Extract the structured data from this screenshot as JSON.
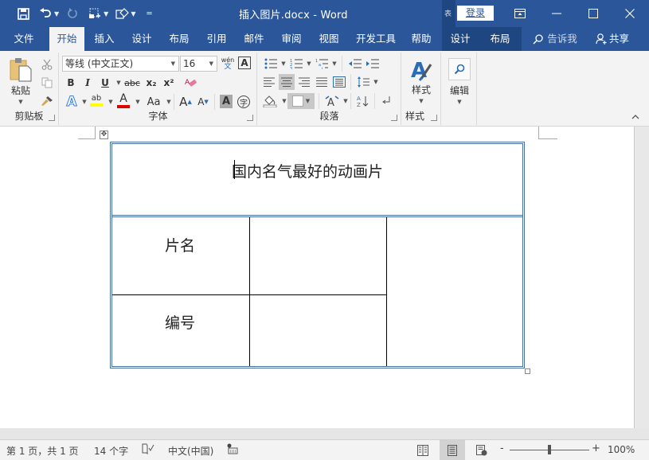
{
  "app": {
    "title": "插入图片.docx  -  Word",
    "login_label": "登录",
    "context_indicator": "表"
  },
  "quick_access": {
    "save_icon": "save-icon",
    "undo_icon": "undo-icon",
    "redo_icon": "redo-icon",
    "insert_picture_icon": "insert-picture-icon",
    "shapes_icon": "shapes-icon",
    "customize_icon": "customize-qat-icon"
  },
  "window_controls": [
    "ribbon-display-options",
    "minimize",
    "maximize",
    "close"
  ],
  "tabs": [
    {
      "label": "文件",
      "active": false
    },
    {
      "label": "开始",
      "active": true
    },
    {
      "label": "插入",
      "active": false
    },
    {
      "label": "设计",
      "active": false
    },
    {
      "label": "布局",
      "active": false
    },
    {
      "label": "引用",
      "active": false
    },
    {
      "label": "邮件",
      "active": false
    },
    {
      "label": "审阅",
      "active": false
    },
    {
      "label": "视图",
      "active": false
    },
    {
      "label": "开发工具",
      "active": false
    },
    {
      "label": "帮助",
      "active": false
    }
  ],
  "context_tabs": [
    {
      "label": "设计"
    },
    {
      "label": "布局"
    }
  ],
  "tell_me": "告诉我",
  "share": "共享",
  "ribbon": {
    "clipboard": {
      "label": "剪贴板",
      "paste_label": "粘贴"
    },
    "font": {
      "label": "字体",
      "font_name": "等线 (中文正文)",
      "font_size": "16",
      "phonetic_top": "wén",
      "phonetic_bottom": "文",
      "bold": "B",
      "italic": "I",
      "underline": "U",
      "strikethrough": "abc",
      "subscript": "x₂",
      "superscript": "x²",
      "change_case": "Aa",
      "grow": "A",
      "shrink": "A",
      "shading_char": "A",
      "enclose_char": "字",
      "font_color_hex": "#e00000",
      "highlight_hex": "#ffff00"
    },
    "paragraph": {
      "label": "段落"
    },
    "styles": {
      "label": "样式",
      "button_label": "样式"
    },
    "editing": {
      "button_label": "编辑"
    }
  },
  "document": {
    "table": {
      "title": "国内名气最好的动画片",
      "rows": [
        [
          "片名",
          "",
          ""
        ],
        [
          "编号",
          ""
        ]
      ]
    }
  },
  "status": {
    "page": "第 1 页，共 1 页",
    "words": "14 个字",
    "language": "中文(中国)",
    "zoom": "100%",
    "zoom_minus": "-",
    "zoom_plus": "+",
    "zoom_level_percent": 100
  },
  "colors": {
    "brand": "#2b579a",
    "context_tab": "#1e4680",
    "ribbon_bg": "#f3f3f3",
    "table_border": "#4a6fa5"
  }
}
